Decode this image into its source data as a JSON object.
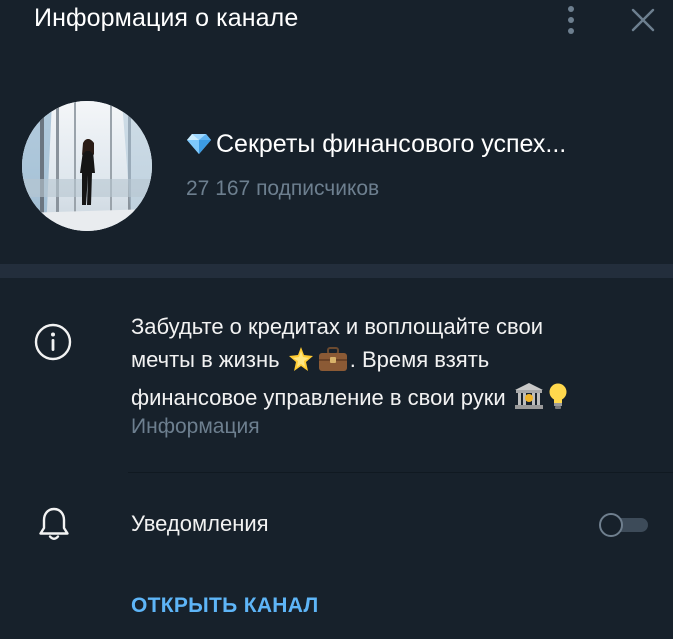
{
  "header": {
    "title": "Информация о канале",
    "menu_icon": "kebab-menu-icon",
    "close_icon": "close-icon"
  },
  "channel": {
    "emoji": "💎",
    "name": "Секреты финансового успех...",
    "subscribers": "27 167 подписчиков",
    "avatar": "avatar-photo"
  },
  "info": {
    "line1": "Забудьте о кредитах и воплощайте свои",
    "line2_a": "мечты в жизнь",
    "emoji_star": "🌟",
    "emoji_briefcase": "💼",
    "line2_b": ". Время взять",
    "line3": "финансовое управление в свои руки",
    "emoji_bank": "🏦",
    "emoji_bulb": "💡",
    "label": "Информация",
    "icon": "info-icon"
  },
  "notifications": {
    "label": "Уведомления",
    "enabled": false,
    "icon": "bell-icon"
  },
  "actions": {
    "open_channel": "ОТКРЫТЬ КАНАЛ"
  },
  "colors": {
    "background": "#17212b",
    "divider_band": "#232e3c",
    "secondary_text": "#6d7f8f",
    "accent": "#5eb5f7"
  }
}
